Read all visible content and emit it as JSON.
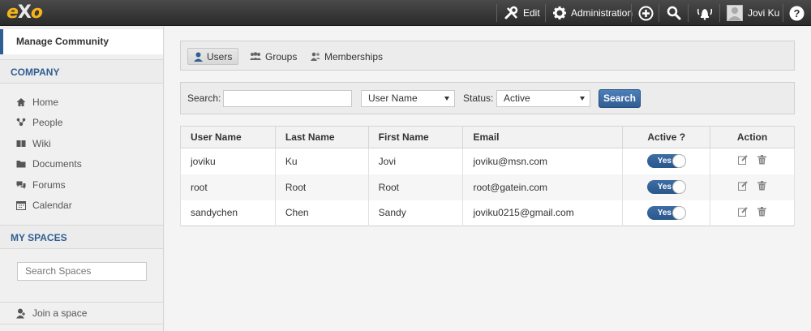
{
  "topbar": {
    "logo": {
      "e": "e",
      "x": "X",
      "o": "o"
    },
    "edit": "Edit",
    "administration": "Administration",
    "user_name": "Jovi Ku"
  },
  "sidebar": {
    "manage_community": "Manage Community",
    "company_title": "COMPANY",
    "company_items": [
      {
        "label": "Home",
        "icon": "home-icon"
      },
      {
        "label": "People",
        "icon": "people-icon"
      },
      {
        "label": "Wiki",
        "icon": "wiki-icon"
      },
      {
        "label": "Documents",
        "icon": "folder-icon"
      },
      {
        "label": "Forums",
        "icon": "forums-icon"
      },
      {
        "label": "Calendar",
        "icon": "calendar-icon"
      }
    ],
    "spaces_title": "MY SPACES",
    "search_spaces_placeholder": "Search Spaces",
    "join_space": "Join a space"
  },
  "tabs": [
    {
      "label": "Users",
      "active": true
    },
    {
      "label": "Groups",
      "active": false
    },
    {
      "label": "Memberships",
      "active": false
    }
  ],
  "filter": {
    "search_label": "Search:",
    "search_value": "",
    "field_select": "User Name",
    "status_label": "Status:",
    "status_select": "Active",
    "search_button": "Search"
  },
  "table": {
    "headers": [
      "User Name",
      "Last Name",
      "First Name",
      "Email",
      "Active ?",
      "Action"
    ],
    "rows": [
      {
        "username": "joviku",
        "last": "Ku",
        "first": "Jovi",
        "email": "joviku@msn.com",
        "active": "Yes"
      },
      {
        "username": "root",
        "last": "Root",
        "first": "Root",
        "email": "root@gatein.com",
        "active": "Yes"
      },
      {
        "username": "sandychen",
        "last": "Chen",
        "first": "Sandy",
        "email": "joviku0215@gmail.com",
        "active": "Yes"
      }
    ]
  },
  "colors": {
    "accent": "#2f5e92",
    "logo": "#f6b41a",
    "topbar": "#333333"
  }
}
